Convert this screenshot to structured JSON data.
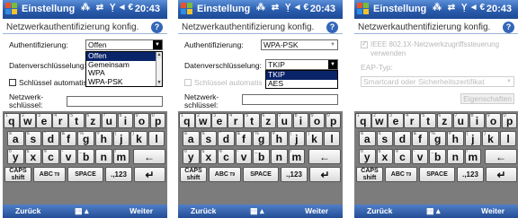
{
  "screens": [
    {
      "title": "Einstellung",
      "status_icons": "⁂ ⇄ Ỵ◄€",
      "clock": "20:43",
      "subheader": "Netzwerkauthentifizierung konfig.",
      "auth_label": "Authentifizierung:",
      "auth_value": "Offen",
      "auth_options": [
        "Offen",
        "Gemeinsam",
        "WPA",
        "WPA-PSK"
      ],
      "auth_selected_index": 0,
      "enc_label": "Datenverschlüsselung:",
      "key_auto_label": "Schlüssel automatis",
      "net_key_label_1": "Netzwerk-",
      "net_key_label_2": "schlüssel:",
      "menu_left": "Zurück",
      "menu_right": "Weiter"
    },
    {
      "title": "Einstellung",
      "status_icons": "⁂ ⇄ Ỵ◄€",
      "clock": "20:43",
      "subheader": "Netzwerkauthentifizierung konfig.",
      "auth_label": "Authentifizierung:",
      "auth_value": "WPA-PSK",
      "enc_label": "Datenverschlüsselung:",
      "enc_value": "TKIP",
      "enc_options": [
        "TKIP",
        "AES"
      ],
      "enc_selected_index": 0,
      "key_auto_label": "Schlüssel automatis",
      "net_key_label_1": "Netzwerk-",
      "net_key_label_2": "schlüssel:",
      "menu_left": "Zurück",
      "menu_right": "Weiter"
    },
    {
      "title": "Einstellung",
      "status_icons": "⁂ ⇄ Ỵ◄€",
      "clock": "20:43",
      "subheader": "Netzwerkauthentifizierung konfig.",
      "ieee_label_1": "IEEE 802.1X-Netzwerkzugriffssteuerung",
      "ieee_label_2": "verwenden",
      "eap_label": "EAP-Typ:",
      "eap_value": "Smartcard oder Sicherheitszertifikat",
      "properties_label": "Eigenschaften",
      "menu_left": "Zurück",
      "menu_right": "Weiter"
    }
  ],
  "keyboard": {
    "row1": [
      [
        "q",
        "1"
      ],
      [
        "w",
        "2"
      ],
      [
        "e",
        "3"
      ],
      [
        "r",
        "4"
      ],
      [
        "t",
        "5"
      ],
      [
        "z",
        "6"
      ],
      [
        "u",
        "7"
      ],
      [
        "i",
        "8"
      ],
      [
        "o",
        "9"
      ],
      [
        "p",
        "0"
      ]
    ],
    "row2": [
      [
        "a",
        "ä"
      ],
      [
        "s",
        "ß"
      ],
      [
        "d",
        "*"
      ],
      [
        "f",
        "&"
      ],
      [
        "g",
        "%"
      ],
      [
        "h",
        "#"
      ],
      [
        "j",
        "("
      ],
      [
        "k",
        ")"
      ],
      [
        "l",
        "'"
      ]
    ],
    "row3": [
      [
        "y",
        "ö"
      ],
      [
        "x",
        "ü"
      ],
      [
        "c",
        "ẽ"
      ],
      [
        "v",
        "-"
      ],
      [
        "b",
        "_"
      ],
      [
        "n",
        "\""
      ],
      [
        "m",
        "/"
      ],
      [
        "",
        ""
      ]
    ],
    "caps_label_1": "CAPS",
    "caps_label_2": "shift",
    "abc_label": "ABC",
    "abc_sub": "T9",
    "space_label": "SPACE",
    "num_label": ".,123",
    "backspace_glyph": "←",
    "enter_glyph": "↵"
  }
}
